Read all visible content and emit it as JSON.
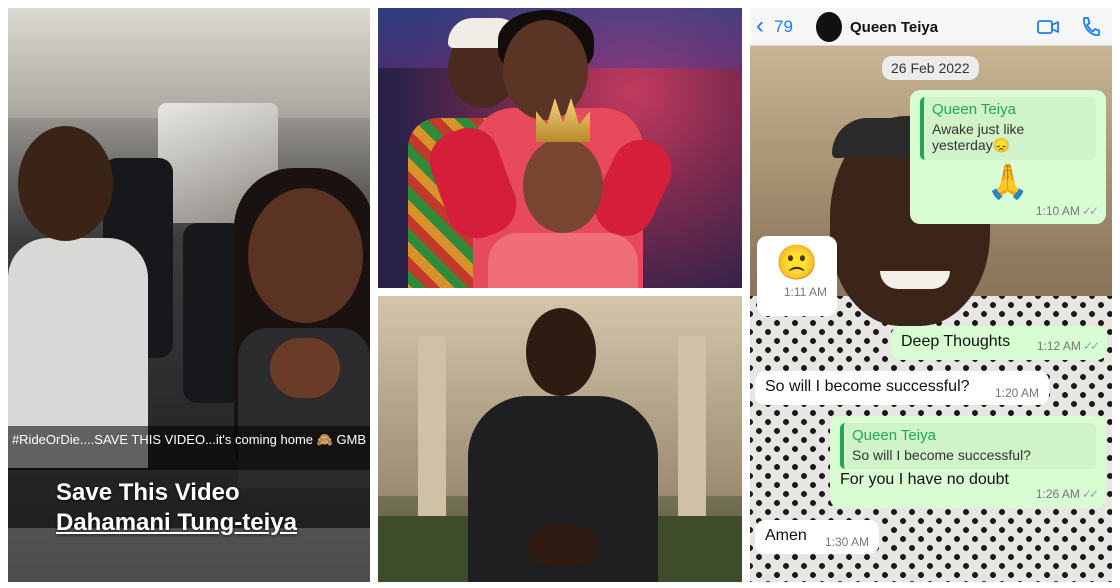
{
  "snapchat_panel": {
    "caption": "#RideOrDie....SAVE THIS VIDEO...it's coming home 🙈 GMB",
    "overlay_line1": "Save This Video",
    "overlay_line2": "Dahamani Tung-teiya"
  },
  "chat": {
    "header": {
      "back_count": "79",
      "contact_name": "Queen Teiya",
      "icons": [
        "chevron-left-icon",
        "video-call-icon",
        "phone-call-icon"
      ],
      "accent_color": "#1e7cf2"
    },
    "date_chip": "26 Feb 2022",
    "messages": [
      {
        "direction": "outgoing",
        "quote_name": "Queen Teiya",
        "quote_text": "Awake just like yesterday😞",
        "text": "🙏",
        "time": "1:10 AM",
        "ticks": "✓✓"
      },
      {
        "direction": "incoming",
        "text": "🙁",
        "time": "1:11 AM"
      },
      {
        "direction": "outgoing",
        "text": "Deep Thoughts",
        "time": "1:12 AM",
        "ticks": "✓✓"
      },
      {
        "direction": "incoming",
        "text": "So will I become successful?",
        "time": "1:20 AM"
      },
      {
        "direction": "outgoing",
        "quote_name": "Queen Teiya",
        "quote_text": "So will I become successful?",
        "text": "For you I have no doubt",
        "time": "1:26 AM",
        "ticks": "✓✓"
      },
      {
        "direction": "incoming",
        "text": "Amen",
        "time": "1:30 AM"
      }
    ],
    "colors": {
      "outgoing_bubble": "#d9fdd3",
      "incoming_bubble": "#ffffff",
      "quote_accent": "#1fa855"
    }
  }
}
